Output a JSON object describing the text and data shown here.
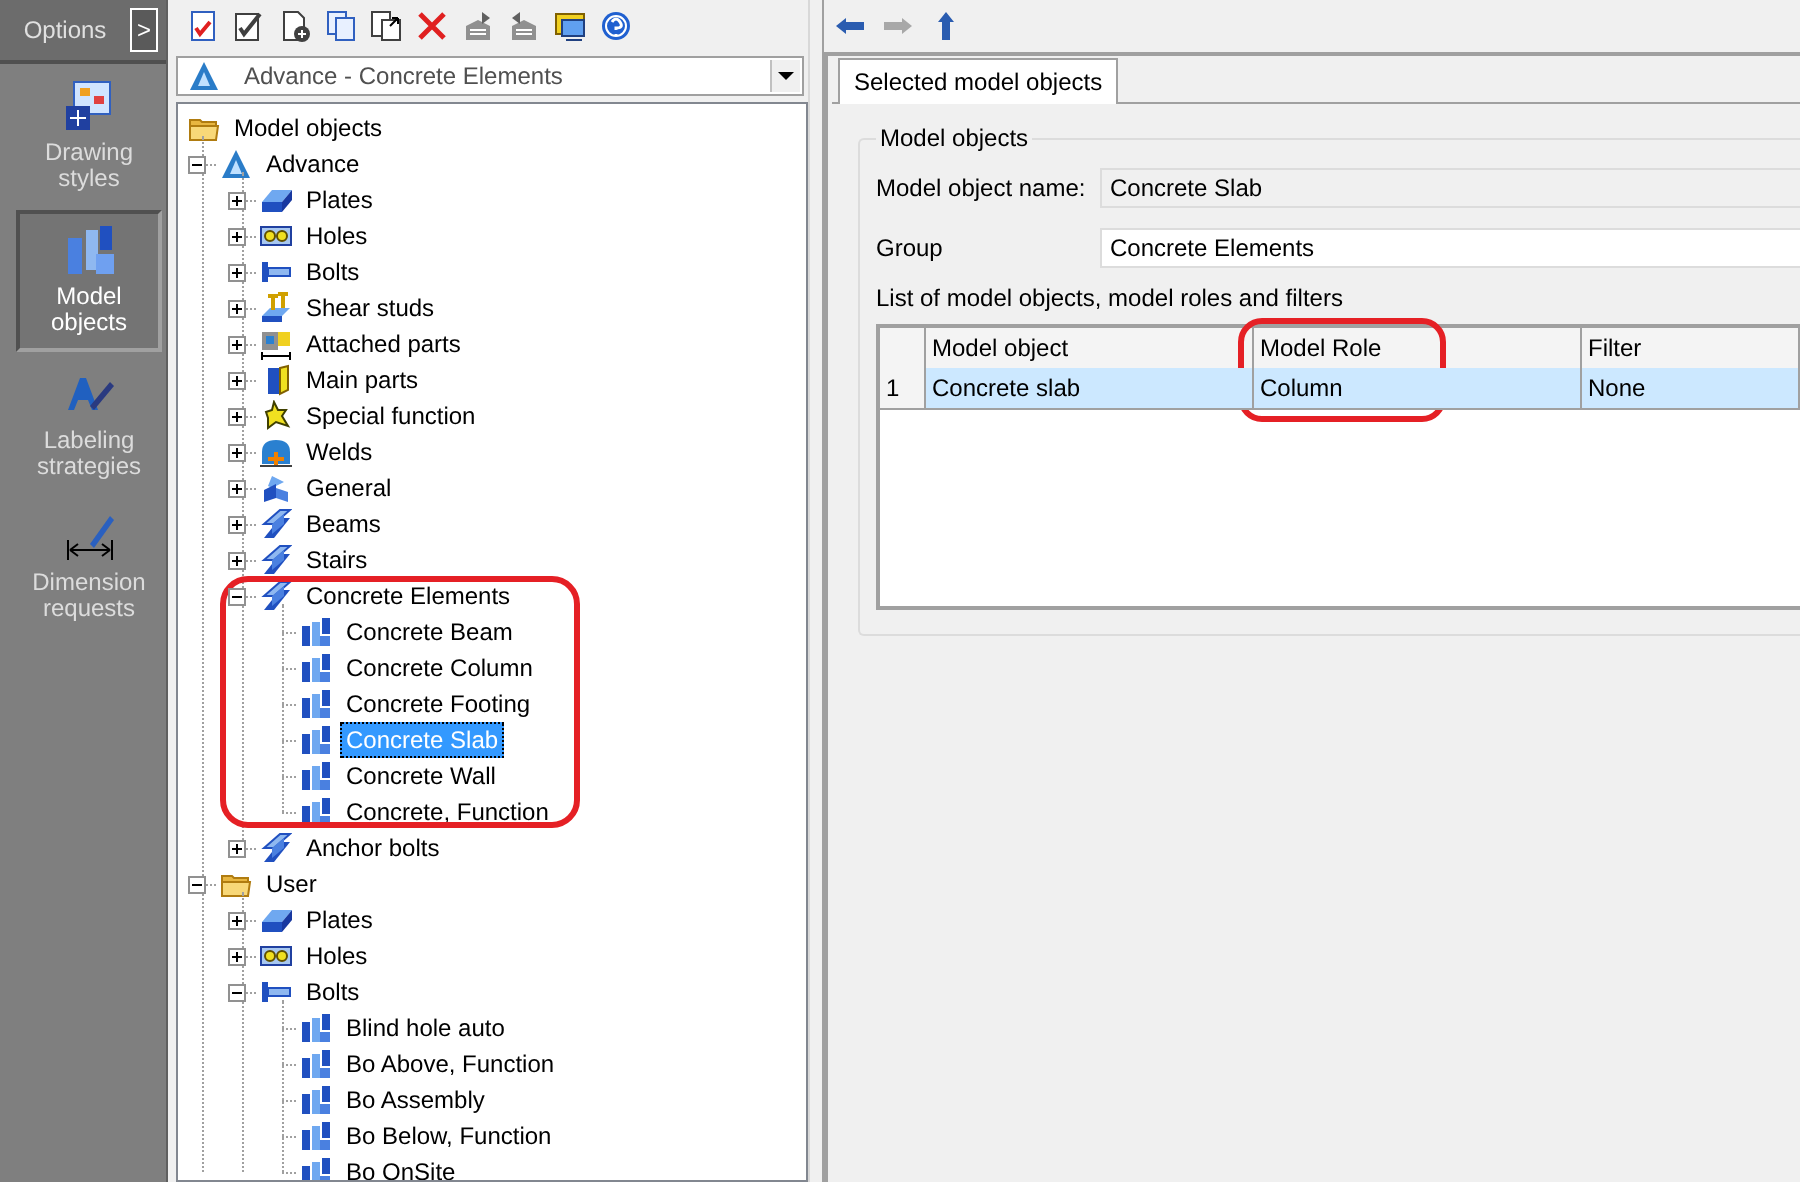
{
  "sidebar": {
    "header": "Options",
    "toggle": ">",
    "items": [
      {
        "label": "Drawing styles",
        "kind": "styles",
        "selected": false
      },
      {
        "label": "Model objects",
        "kind": "objects",
        "selected": true
      },
      {
        "label": "Labeling strategies",
        "kind": "labeling",
        "selected": false
      },
      {
        "label": "Dimension requests",
        "kind": "dimension",
        "selected": false
      }
    ]
  },
  "view_selector": {
    "value": "Advance - Concrete Elements"
  },
  "tree": {
    "label": "Model objects",
    "kind": "folder",
    "selected": false,
    "children": [
      {
        "label": "Advance",
        "kind": "advance",
        "expanded": true,
        "selected": false,
        "children": [
          {
            "label": "Plates",
            "kind": "plate",
            "expanded": false,
            "selected": false,
            "circled": false
          },
          {
            "label": "Holes",
            "kind": "holes",
            "expanded": false,
            "selected": false,
            "circled": false
          },
          {
            "label": "Bolts",
            "kind": "bolt",
            "expanded": false,
            "selected": false,
            "circled": false
          },
          {
            "label": "Shear studs",
            "kind": "studs",
            "expanded": false,
            "selected": false,
            "circled": false
          },
          {
            "label": "Attached parts",
            "kind": "attached",
            "expanded": false,
            "selected": false,
            "circled": false
          },
          {
            "label": "Main parts",
            "kind": "main",
            "expanded": false,
            "selected": false,
            "circled": false
          },
          {
            "label": "Special function",
            "kind": "special",
            "expanded": false,
            "selected": false,
            "circled": false
          },
          {
            "label": "Welds",
            "kind": "weld",
            "expanded": false,
            "selected": false,
            "circled": false
          },
          {
            "label": "General",
            "kind": "general",
            "expanded": false,
            "selected": false,
            "circled": false
          },
          {
            "label": "Beams",
            "kind": "beam",
            "expanded": false,
            "selected": false,
            "circled": false
          },
          {
            "label": "Stairs",
            "kind": "beam",
            "expanded": false,
            "selected": false,
            "circled": false
          },
          {
            "label": "Concrete Elements",
            "kind": "beam",
            "expanded": true,
            "selected": false,
            "circled": true,
            "children": [
              {
                "label": "Concrete Beam",
                "kind": "element",
                "selected": false
              },
              {
                "label": "Concrete Column",
                "kind": "element",
                "selected": false
              },
              {
                "label": "Concrete Footing",
                "kind": "element",
                "selected": false
              },
              {
                "label": "Concrete Slab",
                "kind": "element",
                "selected": true
              },
              {
                "label": "Concrete Wall",
                "kind": "element",
                "selected": false
              },
              {
                "label": "Concrete, Function",
                "kind": "element",
                "selected": false
              }
            ]
          },
          {
            "label": "Anchor bolts",
            "kind": "beam",
            "expanded": false,
            "selected": false,
            "circled": false
          }
        ]
      },
      {
        "label": "User",
        "kind": "folder",
        "expanded": true,
        "selected": false,
        "children": [
          {
            "label": "Plates",
            "kind": "plate",
            "expanded": false,
            "selected": false
          },
          {
            "label": "Holes",
            "kind": "holes",
            "expanded": false,
            "selected": false
          },
          {
            "label": "Bolts",
            "kind": "bolt",
            "expanded": true,
            "selected": false,
            "children": [
              {
                "label": "Blind hole auto",
                "kind": "element",
                "selected": false
              },
              {
                "label": "Bo Above, Function",
                "kind": "element",
                "selected": false
              },
              {
                "label": "Bo Assembly",
                "kind": "element",
                "selected": false
              },
              {
                "label": "Bo Below, Function",
                "kind": "element",
                "selected": false
              },
              {
                "label": "Bo OnSite",
                "kind": "element",
                "selected": false
              }
            ]
          }
        ]
      }
    ]
  },
  "navigation": [
    {
      "kind": "back",
      "disabled": false
    },
    {
      "kind": "forward",
      "disabled": true
    },
    {
      "kind": "up",
      "disabled": false
    }
  ],
  "tabs": [
    {
      "label": "Selected model objects",
      "selected": true
    }
  ],
  "group_box": {
    "title": "Model objects",
    "fields": [
      {
        "label": "Model object name:",
        "value": "Concrete Slab",
        "readonly": true
      },
      {
        "label": "Group",
        "value": "Concrete Elements",
        "readonly": false
      }
    ],
    "table_caption": "List of model objects, model roles and filters",
    "table": {
      "columns": [
        {
          "label": "Model object",
          "circled": false
        },
        {
          "label": "Model Role",
          "circled": true
        },
        {
          "label": "Filter",
          "circled": false
        }
      ],
      "rows": [
        {
          "number": "1",
          "cells": [
            "Concrete slab",
            "Column",
            "None"
          ],
          "selected": true
        }
      ]
    }
  }
}
